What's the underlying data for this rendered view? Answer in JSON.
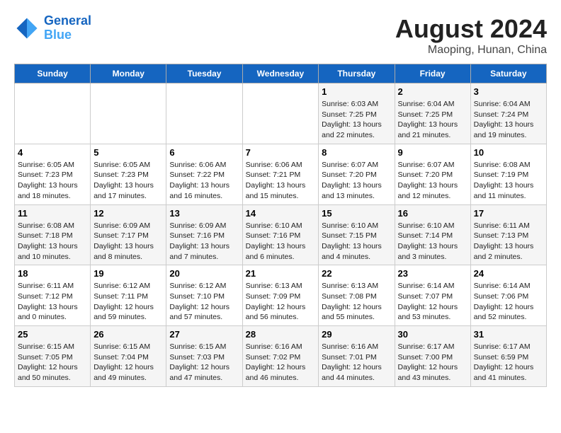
{
  "header": {
    "logo_line1": "General",
    "logo_line2": "Blue",
    "month_year": "August 2024",
    "location": "Maoping, Hunan, China"
  },
  "weekdays": [
    "Sunday",
    "Monday",
    "Tuesday",
    "Wednesday",
    "Thursday",
    "Friday",
    "Saturday"
  ],
  "weeks": [
    [
      {
        "day": "",
        "info": ""
      },
      {
        "day": "",
        "info": ""
      },
      {
        "day": "",
        "info": ""
      },
      {
        "day": "",
        "info": ""
      },
      {
        "day": "1",
        "info": "Sunrise: 6:03 AM\nSunset: 7:25 PM\nDaylight: 13 hours\nand 22 minutes."
      },
      {
        "day": "2",
        "info": "Sunrise: 6:04 AM\nSunset: 7:25 PM\nDaylight: 13 hours\nand 21 minutes."
      },
      {
        "day": "3",
        "info": "Sunrise: 6:04 AM\nSunset: 7:24 PM\nDaylight: 13 hours\nand 19 minutes."
      }
    ],
    [
      {
        "day": "4",
        "info": "Sunrise: 6:05 AM\nSunset: 7:23 PM\nDaylight: 13 hours\nand 18 minutes."
      },
      {
        "day": "5",
        "info": "Sunrise: 6:05 AM\nSunset: 7:23 PM\nDaylight: 13 hours\nand 17 minutes."
      },
      {
        "day": "6",
        "info": "Sunrise: 6:06 AM\nSunset: 7:22 PM\nDaylight: 13 hours\nand 16 minutes."
      },
      {
        "day": "7",
        "info": "Sunrise: 6:06 AM\nSunset: 7:21 PM\nDaylight: 13 hours\nand 15 minutes."
      },
      {
        "day": "8",
        "info": "Sunrise: 6:07 AM\nSunset: 7:20 PM\nDaylight: 13 hours\nand 13 minutes."
      },
      {
        "day": "9",
        "info": "Sunrise: 6:07 AM\nSunset: 7:20 PM\nDaylight: 13 hours\nand 12 minutes."
      },
      {
        "day": "10",
        "info": "Sunrise: 6:08 AM\nSunset: 7:19 PM\nDaylight: 13 hours\nand 11 minutes."
      }
    ],
    [
      {
        "day": "11",
        "info": "Sunrise: 6:08 AM\nSunset: 7:18 PM\nDaylight: 13 hours\nand 10 minutes."
      },
      {
        "day": "12",
        "info": "Sunrise: 6:09 AM\nSunset: 7:17 PM\nDaylight: 13 hours\nand 8 minutes."
      },
      {
        "day": "13",
        "info": "Sunrise: 6:09 AM\nSunset: 7:16 PM\nDaylight: 13 hours\nand 7 minutes."
      },
      {
        "day": "14",
        "info": "Sunrise: 6:10 AM\nSunset: 7:16 PM\nDaylight: 13 hours\nand 6 minutes."
      },
      {
        "day": "15",
        "info": "Sunrise: 6:10 AM\nSunset: 7:15 PM\nDaylight: 13 hours\nand 4 minutes."
      },
      {
        "day": "16",
        "info": "Sunrise: 6:10 AM\nSunset: 7:14 PM\nDaylight: 13 hours\nand 3 minutes."
      },
      {
        "day": "17",
        "info": "Sunrise: 6:11 AM\nSunset: 7:13 PM\nDaylight: 13 hours\nand 2 minutes."
      }
    ],
    [
      {
        "day": "18",
        "info": "Sunrise: 6:11 AM\nSunset: 7:12 PM\nDaylight: 13 hours\nand 0 minutes."
      },
      {
        "day": "19",
        "info": "Sunrise: 6:12 AM\nSunset: 7:11 PM\nDaylight: 12 hours\nand 59 minutes."
      },
      {
        "day": "20",
        "info": "Sunrise: 6:12 AM\nSunset: 7:10 PM\nDaylight: 12 hours\nand 57 minutes."
      },
      {
        "day": "21",
        "info": "Sunrise: 6:13 AM\nSunset: 7:09 PM\nDaylight: 12 hours\nand 56 minutes."
      },
      {
        "day": "22",
        "info": "Sunrise: 6:13 AM\nSunset: 7:08 PM\nDaylight: 12 hours\nand 55 minutes."
      },
      {
        "day": "23",
        "info": "Sunrise: 6:14 AM\nSunset: 7:07 PM\nDaylight: 12 hours\nand 53 minutes."
      },
      {
        "day": "24",
        "info": "Sunrise: 6:14 AM\nSunset: 7:06 PM\nDaylight: 12 hours\nand 52 minutes."
      }
    ],
    [
      {
        "day": "25",
        "info": "Sunrise: 6:15 AM\nSunset: 7:05 PM\nDaylight: 12 hours\nand 50 minutes."
      },
      {
        "day": "26",
        "info": "Sunrise: 6:15 AM\nSunset: 7:04 PM\nDaylight: 12 hours\nand 49 minutes."
      },
      {
        "day": "27",
        "info": "Sunrise: 6:15 AM\nSunset: 7:03 PM\nDaylight: 12 hours\nand 47 minutes."
      },
      {
        "day": "28",
        "info": "Sunrise: 6:16 AM\nSunset: 7:02 PM\nDaylight: 12 hours\nand 46 minutes."
      },
      {
        "day": "29",
        "info": "Sunrise: 6:16 AM\nSunset: 7:01 PM\nDaylight: 12 hours\nand 44 minutes."
      },
      {
        "day": "30",
        "info": "Sunrise: 6:17 AM\nSunset: 7:00 PM\nDaylight: 12 hours\nand 43 minutes."
      },
      {
        "day": "31",
        "info": "Sunrise: 6:17 AM\nSunset: 6:59 PM\nDaylight: 12 hours\nand 41 minutes."
      }
    ]
  ]
}
